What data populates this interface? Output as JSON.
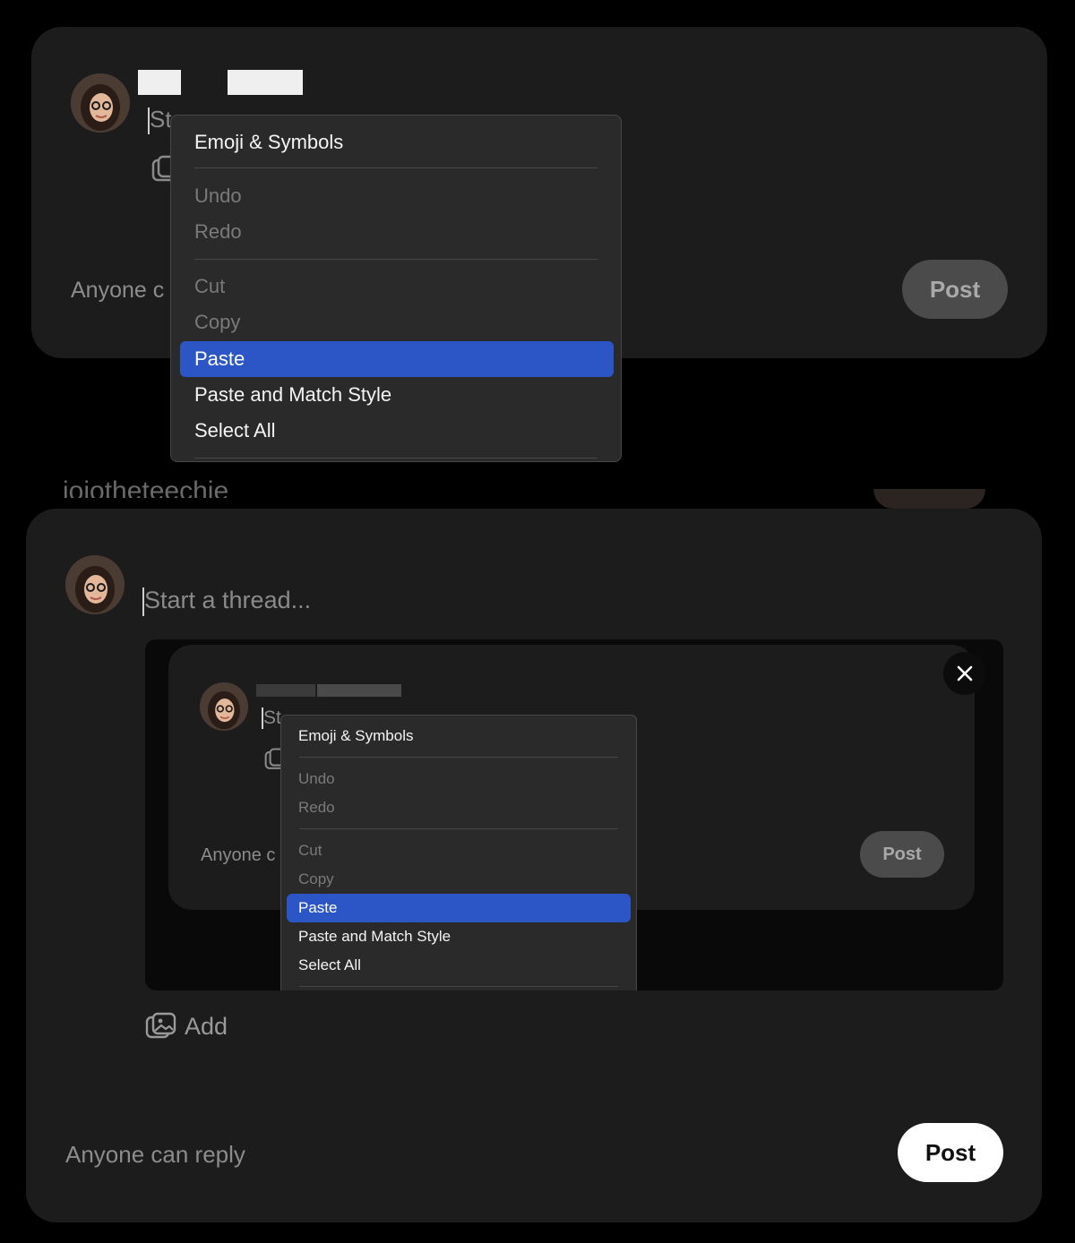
{
  "colors": {
    "background": "#000000",
    "card": "#1c1c1c",
    "menu_background": "#2a2a2a",
    "menu_highlight": "#2c56c6",
    "post_disabled": "#4b4b4b",
    "post_enabled": "#ffffff"
  },
  "top_composer": {
    "placeholder": "St",
    "reply_setting": "Anyone c",
    "post_label": "Post",
    "context_menu": {
      "items": [
        {
          "label": "Emoji & Symbols",
          "state": "enabled"
        },
        {
          "label": "Undo",
          "state": "disabled"
        },
        {
          "label": "Redo",
          "state": "disabled"
        },
        {
          "label": "Cut",
          "state": "disabled"
        },
        {
          "label": "Copy",
          "state": "disabled"
        },
        {
          "label": "Paste",
          "state": "selected"
        },
        {
          "label": "Paste and Match Style",
          "state": "enabled"
        },
        {
          "label": "Select All",
          "state": "enabled"
        }
      ]
    }
  },
  "background_partial_text": "jojotheteechie",
  "main_composer": {
    "placeholder": "Start a thread...",
    "add_label": "Add",
    "reply_setting": "Anyone can reply",
    "post_label": "Post",
    "close_icon": "close-icon",
    "attachment_icon": "image-attach-icon",
    "attached_screenshot": {
      "placeholder": "St",
      "reply_setting": "Anyone c",
      "post_label": "Post",
      "context_menu": {
        "items": [
          {
            "label": "Emoji & Symbols",
            "state": "enabled"
          },
          {
            "label": "Undo",
            "state": "disabled"
          },
          {
            "label": "Redo",
            "state": "disabled"
          },
          {
            "label": "Cut",
            "state": "disabled"
          },
          {
            "label": "Copy",
            "state": "disabled"
          },
          {
            "label": "Paste",
            "state": "selected"
          },
          {
            "label": "Paste and Match Style",
            "state": "enabled"
          },
          {
            "label": "Select All",
            "state": "enabled"
          }
        ]
      }
    }
  }
}
